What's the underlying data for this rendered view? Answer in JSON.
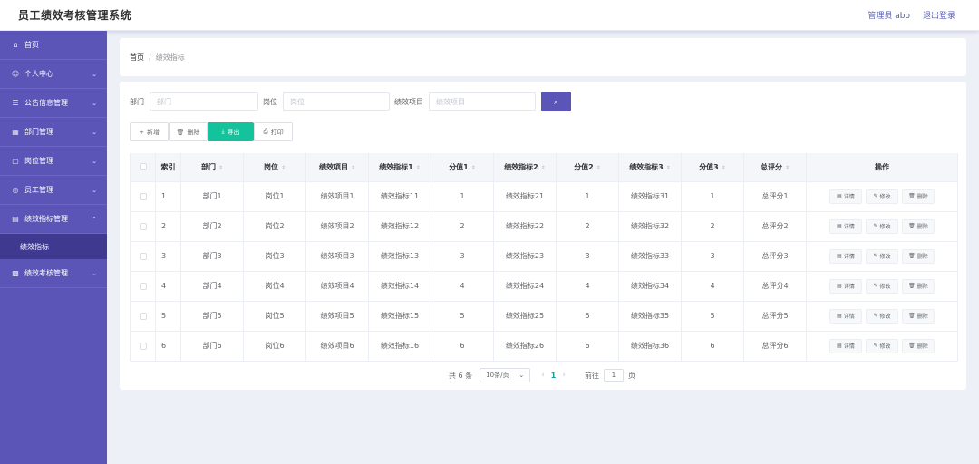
{
  "header": {
    "title": "员工绩效考核管理系统",
    "user": "管理员 abo",
    "logout": "退出登录"
  },
  "sidebar": {
    "items": [
      {
        "label": "首页",
        "icon": "⌂"
      },
      {
        "label": "个人中心",
        "icon": "☺"
      },
      {
        "label": "公告信息管理",
        "icon": "☰"
      },
      {
        "label": "部门管理",
        "icon": "▦"
      },
      {
        "label": "岗位管理",
        "icon": "▢"
      },
      {
        "label": "员工管理",
        "icon": "◎"
      },
      {
        "label": "绩效指标管理",
        "icon": "▤"
      },
      {
        "label": "绩效考核管理",
        "icon": "▩"
      }
    ],
    "submenu_label": "绩效指标",
    "chevron": "⌄"
  },
  "breadcrumb": {
    "home": "首页",
    "separator": "/",
    "current": "绩效指标"
  },
  "search": {
    "dept_label": "部门",
    "dept_placeholder": "部门",
    "post_label": "岗位",
    "post_placeholder": "岗位",
    "item_label": "绩效项目",
    "item_placeholder": "绩效项目",
    "search_icon": "⌕"
  },
  "actions": {
    "add_label": "新增",
    "add_icon": "+",
    "delete_label": "删除",
    "delete_icon": "🗑",
    "export_label": "导出",
    "export_icon": "⤓",
    "print_label": "打印",
    "print_icon": "⎙"
  },
  "table": {
    "headers": [
      "索引",
      "部门",
      "岗位",
      "绩效项目",
      "绩效指标1",
      "分值1",
      "绩效指标2",
      "分值2",
      "绩效指标3",
      "分值3",
      "总评分",
      "操作"
    ],
    "sort_icon": "⇕",
    "ops": {
      "detail": "详情",
      "edit": "修改",
      "delete": "删除",
      "detail_icon": "▤",
      "edit_icon": "✎",
      "delete_icon": "🗑"
    },
    "rows": [
      [
        "1",
        "部门1",
        "岗位1",
        "绩效项目1",
        "绩效指标11",
        "1",
        "绩效指标21",
        "1",
        "绩效指标31",
        "1",
        "总评分1"
      ],
      [
        "2",
        "部门2",
        "岗位2",
        "绩效项目2",
        "绩效指标12",
        "2",
        "绩效指标22",
        "2",
        "绩效指标32",
        "2",
        "总评分2"
      ],
      [
        "3",
        "部门3",
        "岗位3",
        "绩效项目3",
        "绩效指标13",
        "3",
        "绩效指标23",
        "3",
        "绩效指标33",
        "3",
        "总评分3"
      ],
      [
        "4",
        "部门4",
        "岗位4",
        "绩效项目4",
        "绩效指标14",
        "4",
        "绩效指标24",
        "4",
        "绩效指标34",
        "4",
        "总评分4"
      ],
      [
        "5",
        "部门5",
        "岗位5",
        "绩效项目5",
        "绩效指标15",
        "5",
        "绩效指标25",
        "5",
        "绩效指标35",
        "5",
        "总评分5"
      ],
      [
        "6",
        "部门6",
        "岗位6",
        "绩效项目6",
        "绩效指标16",
        "6",
        "绩效指标26",
        "6",
        "绩效指标36",
        "6",
        "总评分6"
      ]
    ]
  },
  "pagination": {
    "total": "共 6 条",
    "page_size": "10条/页",
    "current_page": "1",
    "goto_label": "前往",
    "goto_value": "1",
    "page_unit": "页",
    "prev_icon": "‹",
    "next_icon": "›",
    "dropdown_icon": "⌄"
  },
  "colors": {
    "primary": "#5b55b8",
    "sidebar_active": "#3f3a8f",
    "export": "#14c29b"
  }
}
